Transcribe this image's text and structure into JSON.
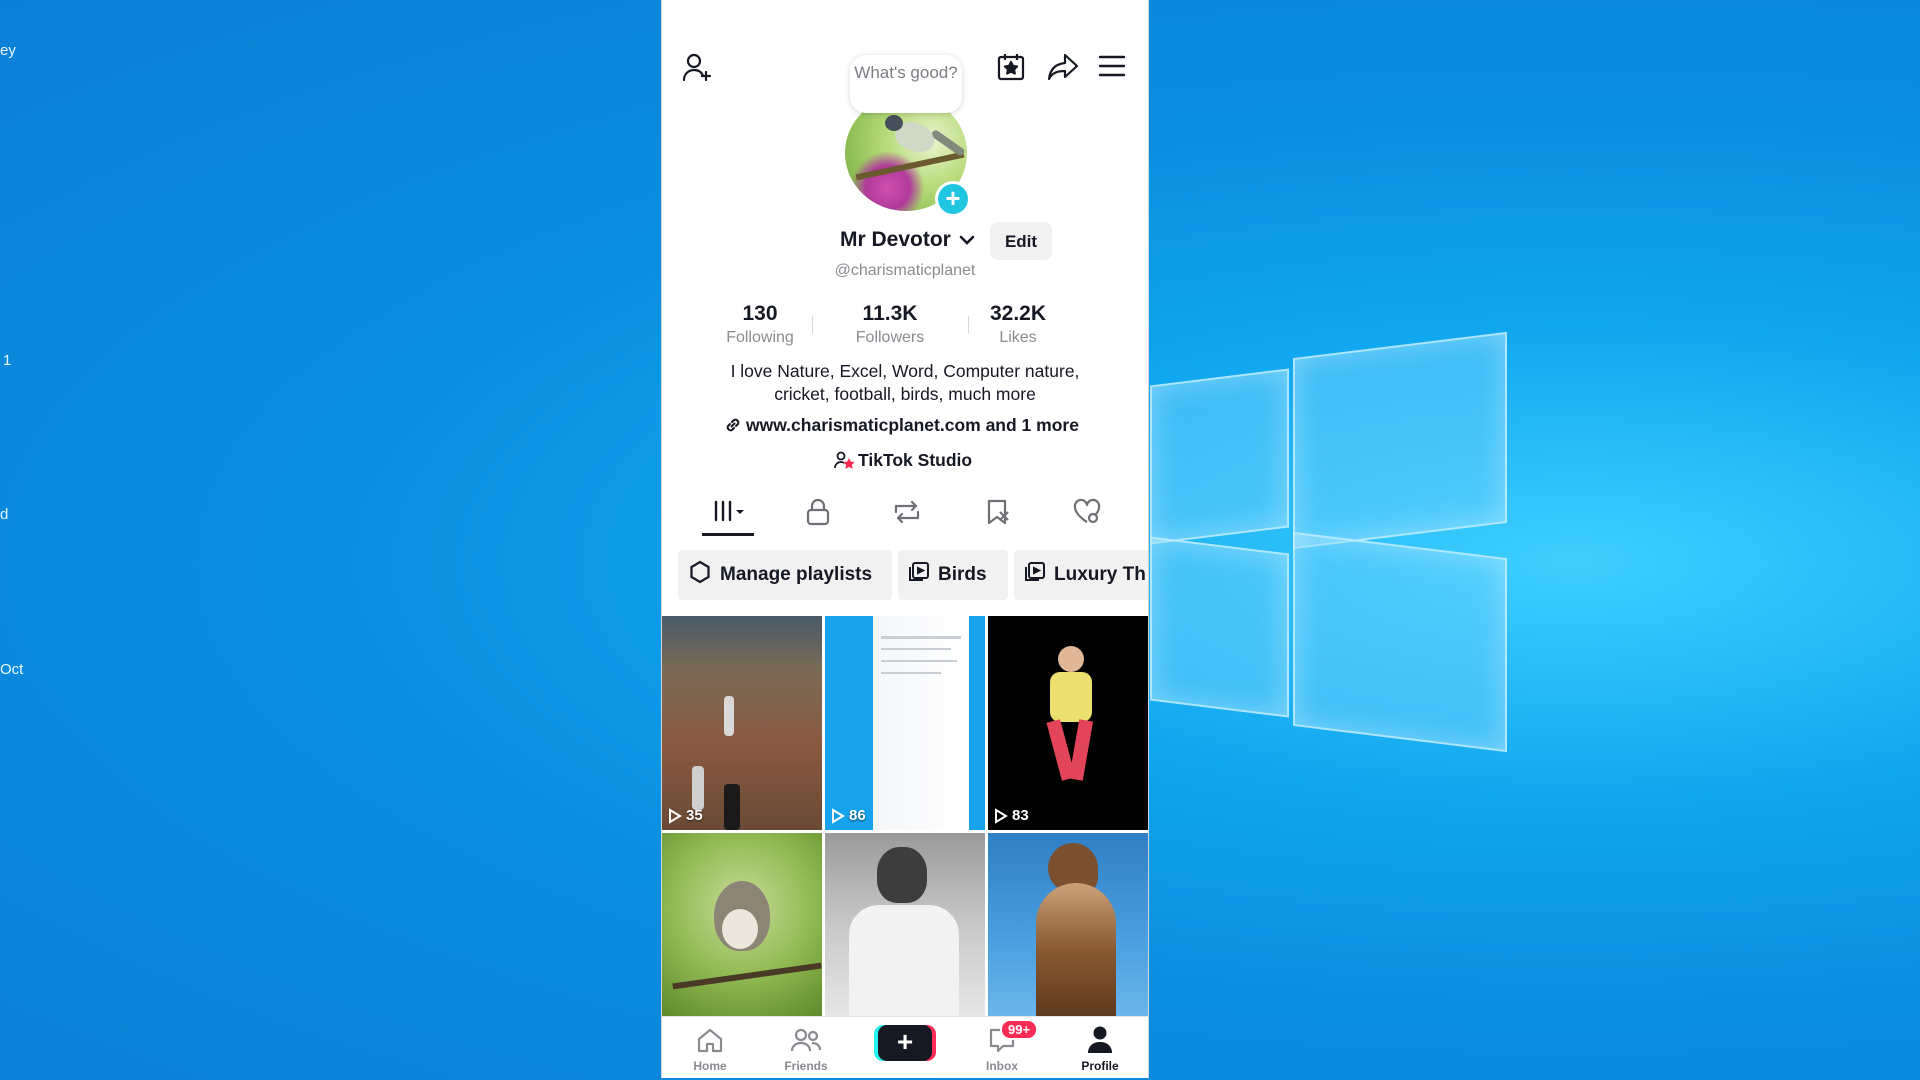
{
  "desktop": {
    "edge_texts": [
      "ey",
      "1",
      "d",
      "Oct"
    ]
  },
  "profile": {
    "bubble_text": "What's good?",
    "name": "Mr Devotor",
    "edit_label": "Edit",
    "handle": "@charismaticplanet",
    "stats": [
      {
        "value": "130",
        "label": "Following"
      },
      {
        "value": "11.3K",
        "label": "Followers"
      },
      {
        "value": "32.2K",
        "label": "Likes"
      }
    ],
    "bio_line1": "I love Nature, Excel, Word, Computer nature,",
    "bio_line2": "cricket, football, birds, much more",
    "link_text": "www.charismaticplanet.com and 1 more",
    "studio_text": "TikTok Studio"
  },
  "chips": [
    {
      "label": "Manage playlists"
    },
    {
      "label": "Birds"
    },
    {
      "label": "Luxury Th"
    }
  ],
  "videos": [
    {
      "views": "35"
    },
    {
      "views": "86"
    },
    {
      "views": "83"
    }
  ],
  "nav": {
    "home": "Home",
    "friends": "Friends",
    "inbox": "Inbox",
    "inbox_badge": "99+",
    "profile": "Profile"
  }
}
